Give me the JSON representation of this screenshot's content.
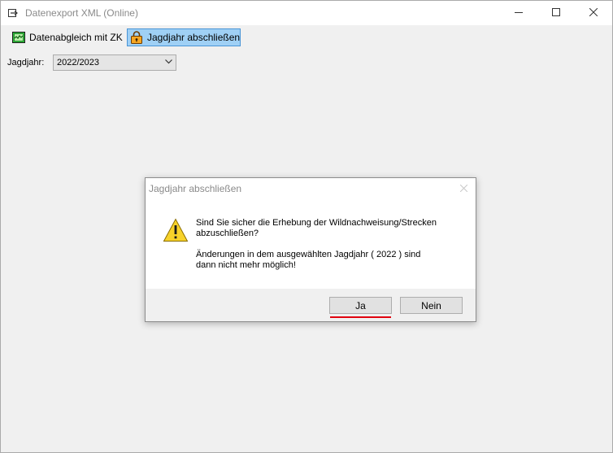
{
  "window": {
    "title": "Datenexport XML (Online)"
  },
  "toolbar": {
    "items": [
      {
        "label": "Datenabgleich mit ZK",
        "icon": "sync-chart-icon"
      },
      {
        "label": "Jagdjahr abschließen",
        "icon": "lock-icon",
        "active": true
      }
    ]
  },
  "form": {
    "jagdjahr_label": "Jagdjahr:",
    "jagdjahr_value": "2022/2023"
  },
  "dialog": {
    "title": "Jagdjahr abschließen",
    "icon": "warning-icon",
    "message_line1": "Sind Sie sicher die Erhebung der Wildnachweisung/Strecken",
    "message_line2": "abzuschließen?",
    "message_line3": "Änderungen in dem ausgewählten Jagdjahr ( 2022 ) sind",
    "message_line4": "dann nicht mehr möglich!",
    "yes_label": "Ja",
    "no_label": "Nein"
  },
  "colors": {
    "active_tab_bg": "#9fd0f5",
    "active_tab_border": "#4a95d6",
    "highlight_underline": "#e0000f",
    "warning_yellow": "#f7d22a"
  }
}
